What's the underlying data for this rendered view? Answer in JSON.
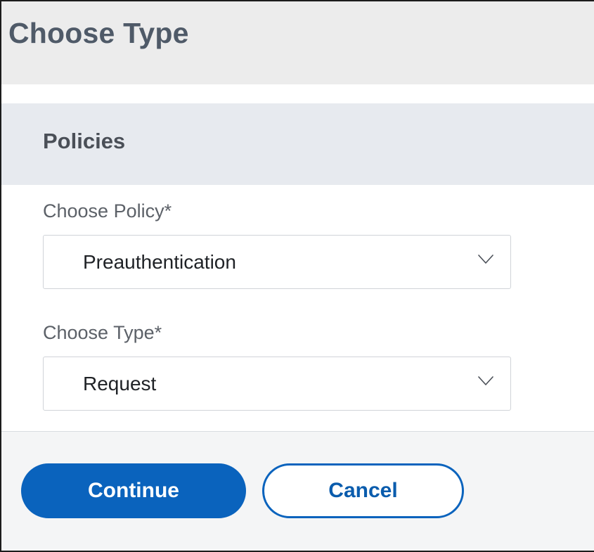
{
  "dialog": {
    "title": "Choose Type"
  },
  "section": {
    "title": "Policies"
  },
  "fields": {
    "policy": {
      "label": "Choose Policy*",
      "value": "Preauthentication"
    },
    "type": {
      "label": "Choose Type*",
      "value": "Request"
    }
  },
  "buttons": {
    "continue_label": "Continue",
    "cancel_label": "Cancel"
  },
  "colors": {
    "accent": "#0a63bd",
    "title_text": "#4f5a68",
    "section_header_bg": "#e7eaef"
  },
  "icons": {
    "select_indicator": "chevron-down-icon"
  }
}
